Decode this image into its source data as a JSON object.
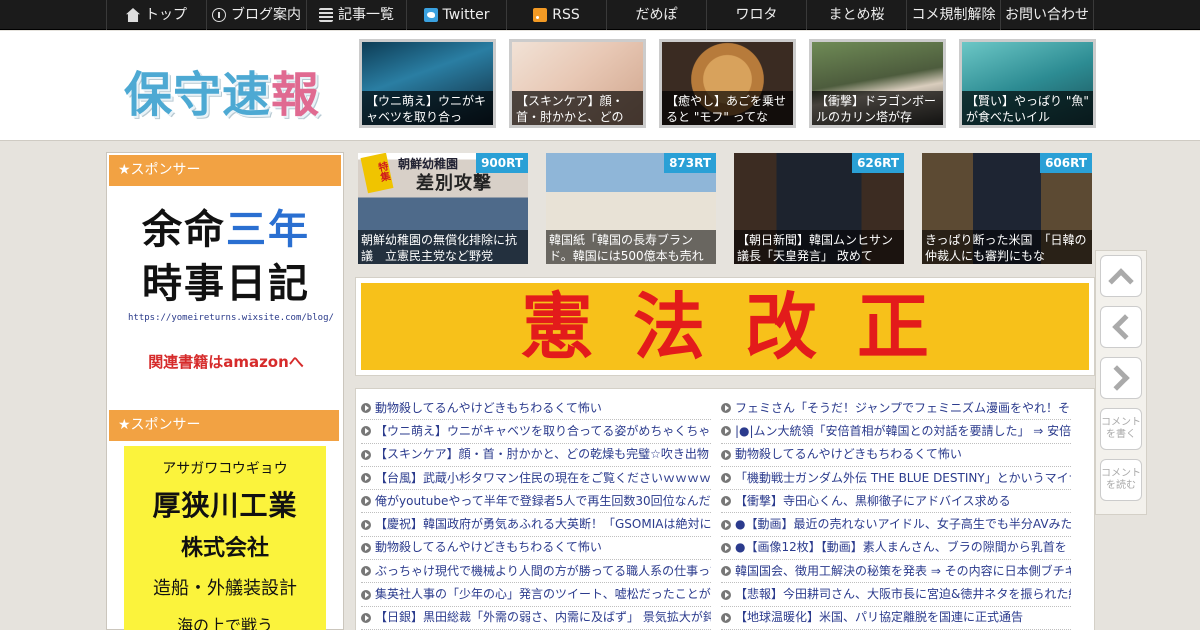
{
  "nav": [
    {
      "label": "トップ",
      "icon": "home-icon",
      "w": 100
    },
    {
      "label": "ブログ案内",
      "icon": "info-icon",
      "w": 100
    },
    {
      "label": "記事一覧",
      "icon": "list-icon",
      "w": 100
    },
    {
      "label": "Twitter",
      "icon": "twitter-icon",
      "w": 100
    },
    {
      "label": "RSS",
      "icon": "rss-icon",
      "w": 100
    },
    {
      "label": "だめぽ",
      "icon": "",
      "w": 100
    },
    {
      "label": "ワロタ",
      "icon": "",
      "w": 100
    },
    {
      "label": "まとめ桜",
      "icon": "",
      "w": 100
    },
    {
      "label": "コメ規制解除",
      "icon": "",
      "w": 94
    },
    {
      "label": "お問い合わせ",
      "icon": "",
      "w": 94
    }
  ],
  "logo": {
    "part1": "保守速",
    "part2": "報"
  },
  "header_thumbs": [
    {
      "caption": "【ウニ萌え】ウニがキャベツを取り合っ"
    },
    {
      "caption": "【スキンケア】顔・首・肘かかと、どの"
    },
    {
      "caption": "【癒やし】あごを乗せると \"モフ\" ってな"
    },
    {
      "caption": "【衝撃】ドラゴンボールのカリン塔が存"
    },
    {
      "caption": "【賢い】やっぱり \"魚\" が食べたいイル"
    }
  ],
  "sidebar": {
    "sponsor1": "★スポンサー",
    "sponsor2": "★スポンサー",
    "ad1": {
      "line1a": "余命",
      "line1b": "三年",
      "line2": "時事日記",
      "url": "https://yomeireturns.wixsite.com/blog/",
      "amazon": "関連書籍はamazonへ"
    },
    "ad2": {
      "kana": "アサガワコウギョウ",
      "corp": "厚狭川工業",
      "kk": "株式会社",
      "work": "造船・外艤装設計",
      "cut": "海の上で戦う"
    }
  },
  "trending": [
    {
      "rt": "900RT",
      "caption": "朝鮮幼稚園の無償化排除に抗議　立憲民主党など野党",
      "sash": "特集",
      "t1": "朝鮮幼稚園",
      "t2": "差別攻撃"
    },
    {
      "rt": "873RT",
      "caption": "韓国紙「韓国の長寿ブランド。韓国には500億本も売れ"
    },
    {
      "rt": "626RT",
      "caption": "【朝日新聞】韓国ムンヒサン議長「天皇発言」 改めて"
    },
    {
      "rt": "606RT",
      "caption": "きっぱり断った米国　「日韓の仲裁人にも審判にもな"
    }
  ],
  "banner": "憲法改正",
  "antenna_left": [
    "動物殺してるんやけどきもちわるくて怖い",
    "【ウニ萌え】ウニがキャベツを取り合ってる姿がめちゃくちゃかわいい",
    "【スキンケア】顔・首・肘かかと、どの乾燥も完璧☆吹き出物",
    "【台風】武蔵小杉タワマン住民の現在をご覧くださいｗｗｗｗ",
    "俺がyoutubeやって半年で登録者5人で再生回数30回位なんだが",
    "【慶祝】韓国政府が勇気あふれる大英断！「GSOMIAは絶対に",
    "動物殺してるんやけどきもちわるくて怖い",
    "ぶっちゃけ現代で機械より人間の方が勝ってる職人系の仕事って",
    "集英社人事の「少年の心」発言のツイート、嘘松だったことが",
    "【日銀】黒田総裁「外需の弱さ、内需に及ばず」 景気拡大が鈍"
  ],
  "antenna_right": [
    "フェミさん「そうだ！ジャンプでフェミニズム漫画をやれ！そ",
    "|●|ムン大統領「安倍首相が韓国との対話を要請した」 ⇒ 安倍首",
    "動物殺してるんやけどきもちわるくて怖い",
    "「機動戦士ガンダム外伝 THE BLUE DESTINY」とかいうマイナー",
    "【衝撃】寺田心くん、黒柳徹子にアドバイス求める",
    "●【動画】最近の売れないアイドル、女子高生でも半分AVみたい",
    "●【画像12枚】【動画】素人まんさん、ブラの隙間から乳首を",
    "韓国国会、徴用工解決の秘策を発表 ⇒ その内容に日本側ブチギレ",
    "【悲報】今田耕司さん、大阪市長に宮迫&徳井ネタを振られた結果",
    "【地球温暖化】米国、パリ協定離脱を国連に正式通告"
  ],
  "side_buttons": {
    "comment_write": "コメントを書く",
    "comment_read": "コメントを読む"
  }
}
